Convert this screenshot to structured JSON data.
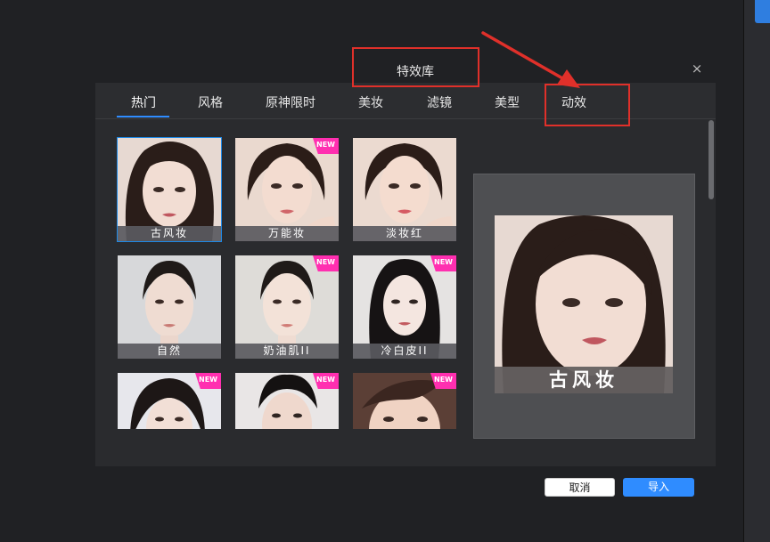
{
  "dialog": {
    "title": "特效库",
    "close": "×"
  },
  "tabs": [
    {
      "label": "热门",
      "active": true
    },
    {
      "label": "风格"
    },
    {
      "label": "原神限时"
    },
    {
      "label": "美妆"
    },
    {
      "label": "滤镜"
    },
    {
      "label": "美型"
    },
    {
      "label": "动效"
    }
  ],
  "effects": [
    {
      "label": "古风妆",
      "selected": true,
      "new": false
    },
    {
      "label": "万能妆",
      "new": true
    },
    {
      "label": "淡妆红",
      "new": false
    },
    {
      "label": "自然",
      "new": false
    },
    {
      "label": "奶油肌II",
      "new": true
    },
    {
      "label": "冷白皮II",
      "new": true
    },
    {
      "label": "",
      "new": true
    },
    {
      "label": "",
      "new": true
    },
    {
      "label": "",
      "new": true
    }
  ],
  "badge_text": "NEW",
  "preview": {
    "label": "古风妆"
  },
  "buttons": {
    "cancel": "取消",
    "import": "导入"
  },
  "colors": {
    "accent": "#2f8cff",
    "badge": "#ff2fb0",
    "annotation": "#e0302a"
  }
}
